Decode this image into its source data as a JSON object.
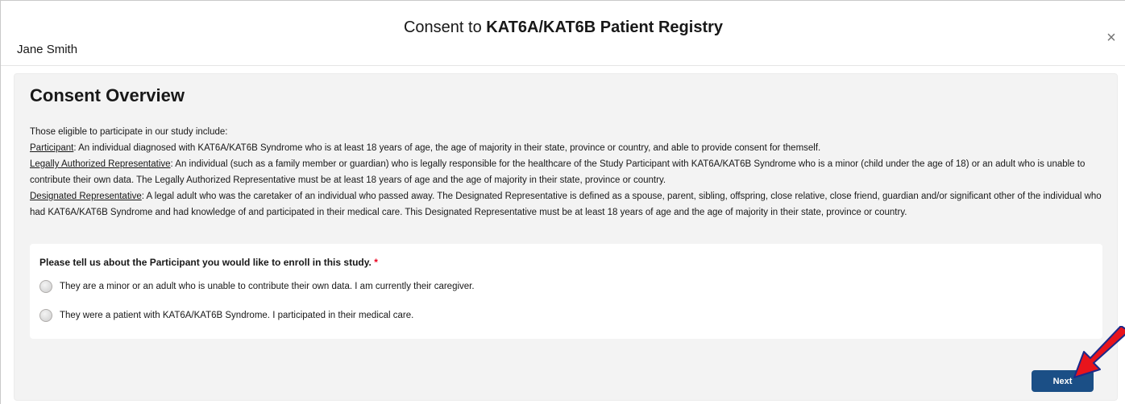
{
  "header": {
    "title_prefix": "Consent to ",
    "title_bold": "KAT6A/KAT6B Patient Registry",
    "user_name": "Jane Smith",
    "close_symbol": "×"
  },
  "overview": {
    "heading": "Consent Overview",
    "intro": "Those eligible to participate in our study include:",
    "items": [
      {
        "term": "Participant",
        "text": ": An individual diagnosed with KAT6A/KAT6B Syndrome who is at least 18 years of age, the age of majority in their state, province or country, and able to provide consent for themself."
      },
      {
        "term": "Legally Authorized Representative",
        "text": ": An individual (such as a family member or guardian) who is legally responsible for the healthcare of the Study Participant with KAT6A/KAT6B Syndrome who is a minor (child under the age of 18) or an adult who is unable to contribute their own data. The Legally Authorized Representative must be at least 18 years of age and the age of majority in their state, province or country."
      },
      {
        "term": "Designated Representative",
        "text": ": A legal adult who was the caretaker of an individual who passed away. The Designated Representative is defined as a spouse, parent, sibling, offspring, close relative, close friend, guardian and/or significant other of the individual who had KAT6A/KAT6B Syndrome and had knowledge of and participated in their medical care. This Designated Representative must be at least 18 years of age and the age of majority in their state, province or country."
      }
    ]
  },
  "question": {
    "label": "Please tell us about the Participant you would like to enroll in this study.",
    "required_marker": "*",
    "options": [
      "They are a minor or an adult who is unable to contribute their own data. I am currently their caregiver.",
      "They were a patient with KAT6A/KAT6B Syndrome. I participated in their medical care."
    ]
  },
  "footer": {
    "next_label": "Next"
  },
  "colors": {
    "primary_button": "#1b4f86",
    "annotation_arrow": "#e8141c",
    "required": "#ea001e"
  },
  "icons": {
    "close": "close-icon",
    "annotation": "red-arrow-icon"
  }
}
